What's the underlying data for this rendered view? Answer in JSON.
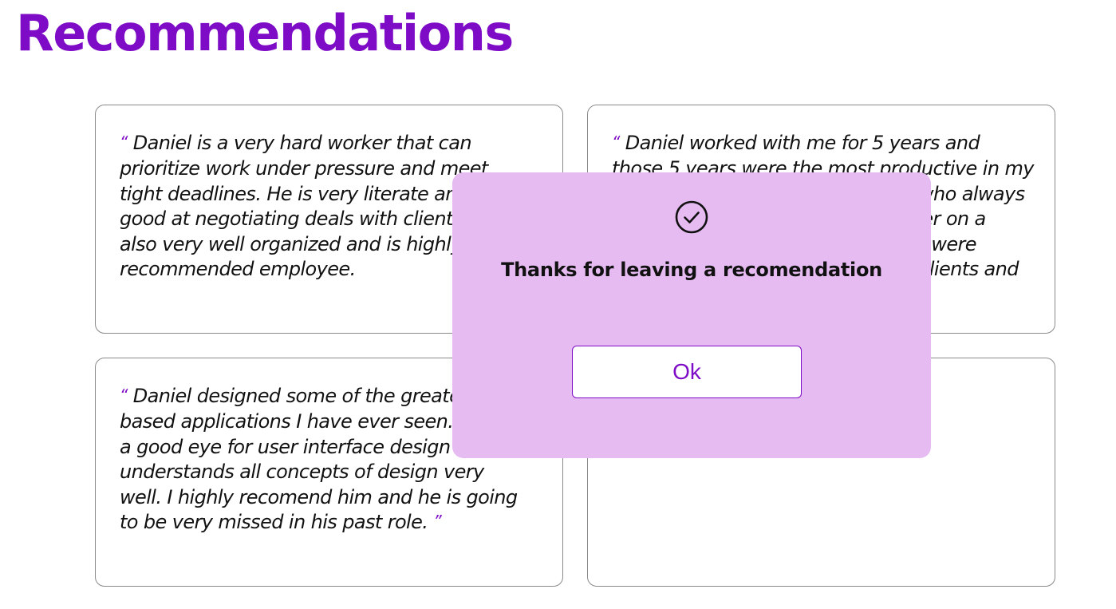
{
  "page": {
    "title": "Recommendations"
  },
  "colors": {
    "accent": "#7e0cc7",
    "modal_background": "#e6bbf2",
    "card_border": "#8a8a8a",
    "text": "#111111"
  },
  "recommendations": [
    {
      "open_quote": "“",
      "text": "Daniel is a very hard worker that can prioritize work under pressure and meet tight deadlines. He is very literate and very good at negotiating deals with clients. He is also very well organized and is highly recommended employee.",
      "close_quote": ""
    },
    {
      "open_quote": "“",
      "text": "Daniel worked with me for 5 years and those 5 years were the most productive in my career. He is a great team player who always has new ideas. We worked together on a project to come up with ideas that were brought outside the company for clients and that made it",
      "close_quote": ""
    },
    {
      "open_quote": "“",
      "text": "Daniel designed some of the greatest web based applications I have ever seen. He has a good eye for user interface design and understands all concepts of design very well. I highly recomend him and he is going to be very missed in his past role.",
      "close_quote": "”"
    },
    {
      "open_quote": "",
      "text": "",
      "close_quote": ""
    }
  ],
  "modal": {
    "icon": "check-circle-icon",
    "message": "Thanks for leaving a recomendation",
    "ok_label": "Ok"
  }
}
